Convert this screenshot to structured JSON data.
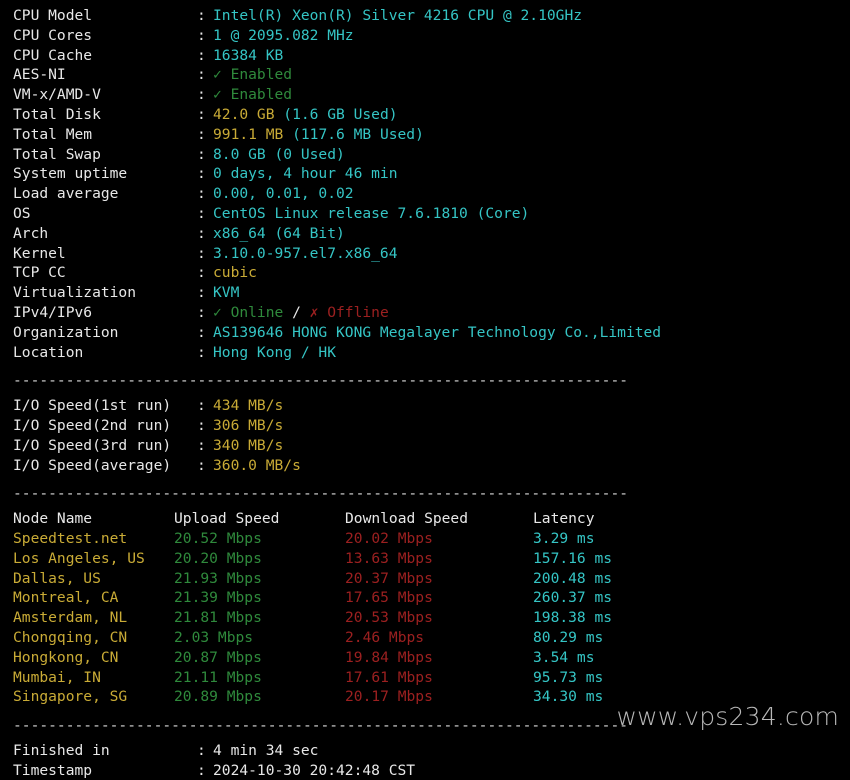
{
  "terminal": {
    "separator": "----------------------------------------------------------------------",
    "colon": ":"
  },
  "system_info": {
    "rows": [
      {
        "label": "CPU Model",
        "value": "Intel(R) Xeon(R) Silver 4216 CPU @ 2.10GHz",
        "color": "cyan"
      },
      {
        "label": "CPU Cores",
        "value": "1 @ 2095.082 MHz",
        "color": "cyan"
      },
      {
        "label": "CPU Cache",
        "value": "16384 KB",
        "color": "cyan"
      },
      {
        "label": "AES-NI",
        "value": "✓ Enabled",
        "color": "green"
      },
      {
        "label": "VM-x/AMD-V",
        "value": "✓ Enabled",
        "color": "green"
      },
      {
        "label": "Total Disk",
        "value": "42.0 GB (1.6 GB Used)",
        "color": "split",
        "head": "42.0 GB",
        "tail": " (1.6 GB Used)"
      },
      {
        "label": "Total Mem",
        "value": "991.1 MB (117.6 MB Used)",
        "color": "split",
        "head": "991.1 MB",
        "tail": " (117.6 MB Used)"
      },
      {
        "label": "Total Swap",
        "value": "8.0 GB (0 Used)",
        "color": "cyan"
      },
      {
        "label": "System uptime",
        "value": "0 days, 4 hour 46 min",
        "color": "cyan"
      },
      {
        "label": "Load average",
        "value": "0.00, 0.01, 0.02",
        "color": "cyan"
      },
      {
        "label": "OS",
        "value": "CentOS Linux release 7.6.1810 (Core)",
        "color": "cyan"
      },
      {
        "label": "Arch",
        "value": "x86_64 (64 Bit)",
        "color": "cyan"
      },
      {
        "label": "Kernel",
        "value": "3.10.0-957.el7.x86_64",
        "color": "cyan"
      },
      {
        "label": "TCP CC",
        "value": "cubic",
        "color": "yellow"
      },
      {
        "label": "Virtualization",
        "value": "KVM",
        "color": "cyan"
      },
      {
        "label": "IPv4/IPv6",
        "value": "✓ Online / ✗ Offline",
        "color": "ipstatus",
        "online": "✓ Online",
        "divider": " / ",
        "offline": "✗ Offline"
      },
      {
        "label": "Organization",
        "value": "AS139646 HONG KONG Megalayer Technology Co.,Limited",
        "color": "cyan"
      },
      {
        "label": "Location",
        "value": "Hong Kong / HK",
        "color": "cyan"
      }
    ]
  },
  "io_speed": {
    "rows": [
      {
        "label": "I/O Speed(1st run)",
        "value": "434 MB/s"
      },
      {
        "label": "I/O Speed(2nd run)",
        "value": "306 MB/s"
      },
      {
        "label": "I/O Speed(3rd run)",
        "value": "340 MB/s"
      },
      {
        "label": "I/O Speed(average)",
        "value": "360.0 MB/s"
      }
    ]
  },
  "speedtest": {
    "headers": {
      "node": "Node Name",
      "upload": "Upload Speed",
      "download": "Download Speed",
      "latency": "Latency"
    },
    "rows": [
      {
        "node": "Speedtest.net",
        "upload": "20.52 Mbps",
        "download": "20.02 Mbps",
        "latency": "3.29 ms"
      },
      {
        "node": "Los Angeles, US",
        "upload": "20.20 Mbps",
        "download": "13.63 Mbps",
        "latency": "157.16 ms"
      },
      {
        "node": "Dallas, US",
        "upload": "21.93 Mbps",
        "download": "20.37 Mbps",
        "latency": "200.48 ms"
      },
      {
        "node": "Montreal, CA",
        "upload": "21.39 Mbps",
        "download": "17.65 Mbps",
        "latency": "260.37 ms"
      },
      {
        "node": "Amsterdam, NL",
        "upload": "21.81 Mbps",
        "download": "20.53 Mbps",
        "latency": "198.38 ms"
      },
      {
        "node": "Chongqing, CN",
        "upload": "2.03 Mbps",
        "download": "2.46 Mbps",
        "latency": "80.29 ms"
      },
      {
        "node": "Hongkong, CN",
        "upload": "20.87 Mbps",
        "download": "19.84 Mbps",
        "latency": "3.54 ms"
      },
      {
        "node": "Mumbai, IN",
        "upload": "21.11 Mbps",
        "download": "17.61 Mbps",
        "latency": "95.73 ms"
      },
      {
        "node": "Singapore, SG",
        "upload": "20.89 Mbps",
        "download": "20.17 Mbps",
        "latency": "34.30 ms"
      }
    ]
  },
  "footer": {
    "rows": [
      {
        "label": "Finished in",
        "value": "4 min 34 sec"
      },
      {
        "label": "Timestamp",
        "value": "2024-10-30 20:42:48 CST"
      }
    ]
  },
  "watermark": {
    "text": "www.vps234.com"
  },
  "palette": {
    "background": "#000000",
    "white": "#e8e8e8",
    "cyan": "#35c5c5",
    "yellow": "#c9ab36",
    "green": "#2f8a3c",
    "red": "#9c2020"
  }
}
